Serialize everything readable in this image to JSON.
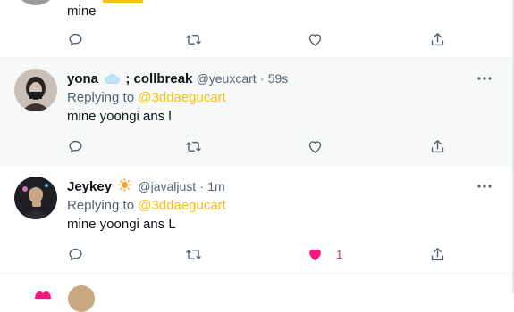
{
  "tweets": [
    {
      "text": "mine",
      "actions": {
        "like_count": ""
      }
    },
    {
      "display_name": "yona",
      "emoji": "cloud-emoji",
      "display_name_suffix": "; collbreak",
      "handle": "@yeuxcart",
      "separator": "·",
      "time": "59s",
      "replying_to_label": "Replying to",
      "replying_to_handle": "@3ddaegucart",
      "text": "mine yoongi ans l",
      "actions": {
        "like_count": ""
      }
    },
    {
      "display_name": "Jeykey",
      "emoji": "sun-emoji",
      "handle": "@javaljust",
      "separator": "·",
      "time": "1m",
      "replying_to_label": "Replying to",
      "replying_to_handle": "@3ddaegucart",
      "text": "mine yoongi ans L",
      "actions": {
        "like_count": "1",
        "liked": true
      }
    }
  ],
  "colors": {
    "accent_mention": "#f4c20d",
    "like_active": "#f91880",
    "icon_gray": "#536471",
    "highlight_bg": "#f7f9f9"
  },
  "icons": {
    "reply": "reply-icon",
    "retweet": "retweet-icon",
    "like": "heart-icon",
    "share": "share-icon",
    "more": "more-icon"
  }
}
